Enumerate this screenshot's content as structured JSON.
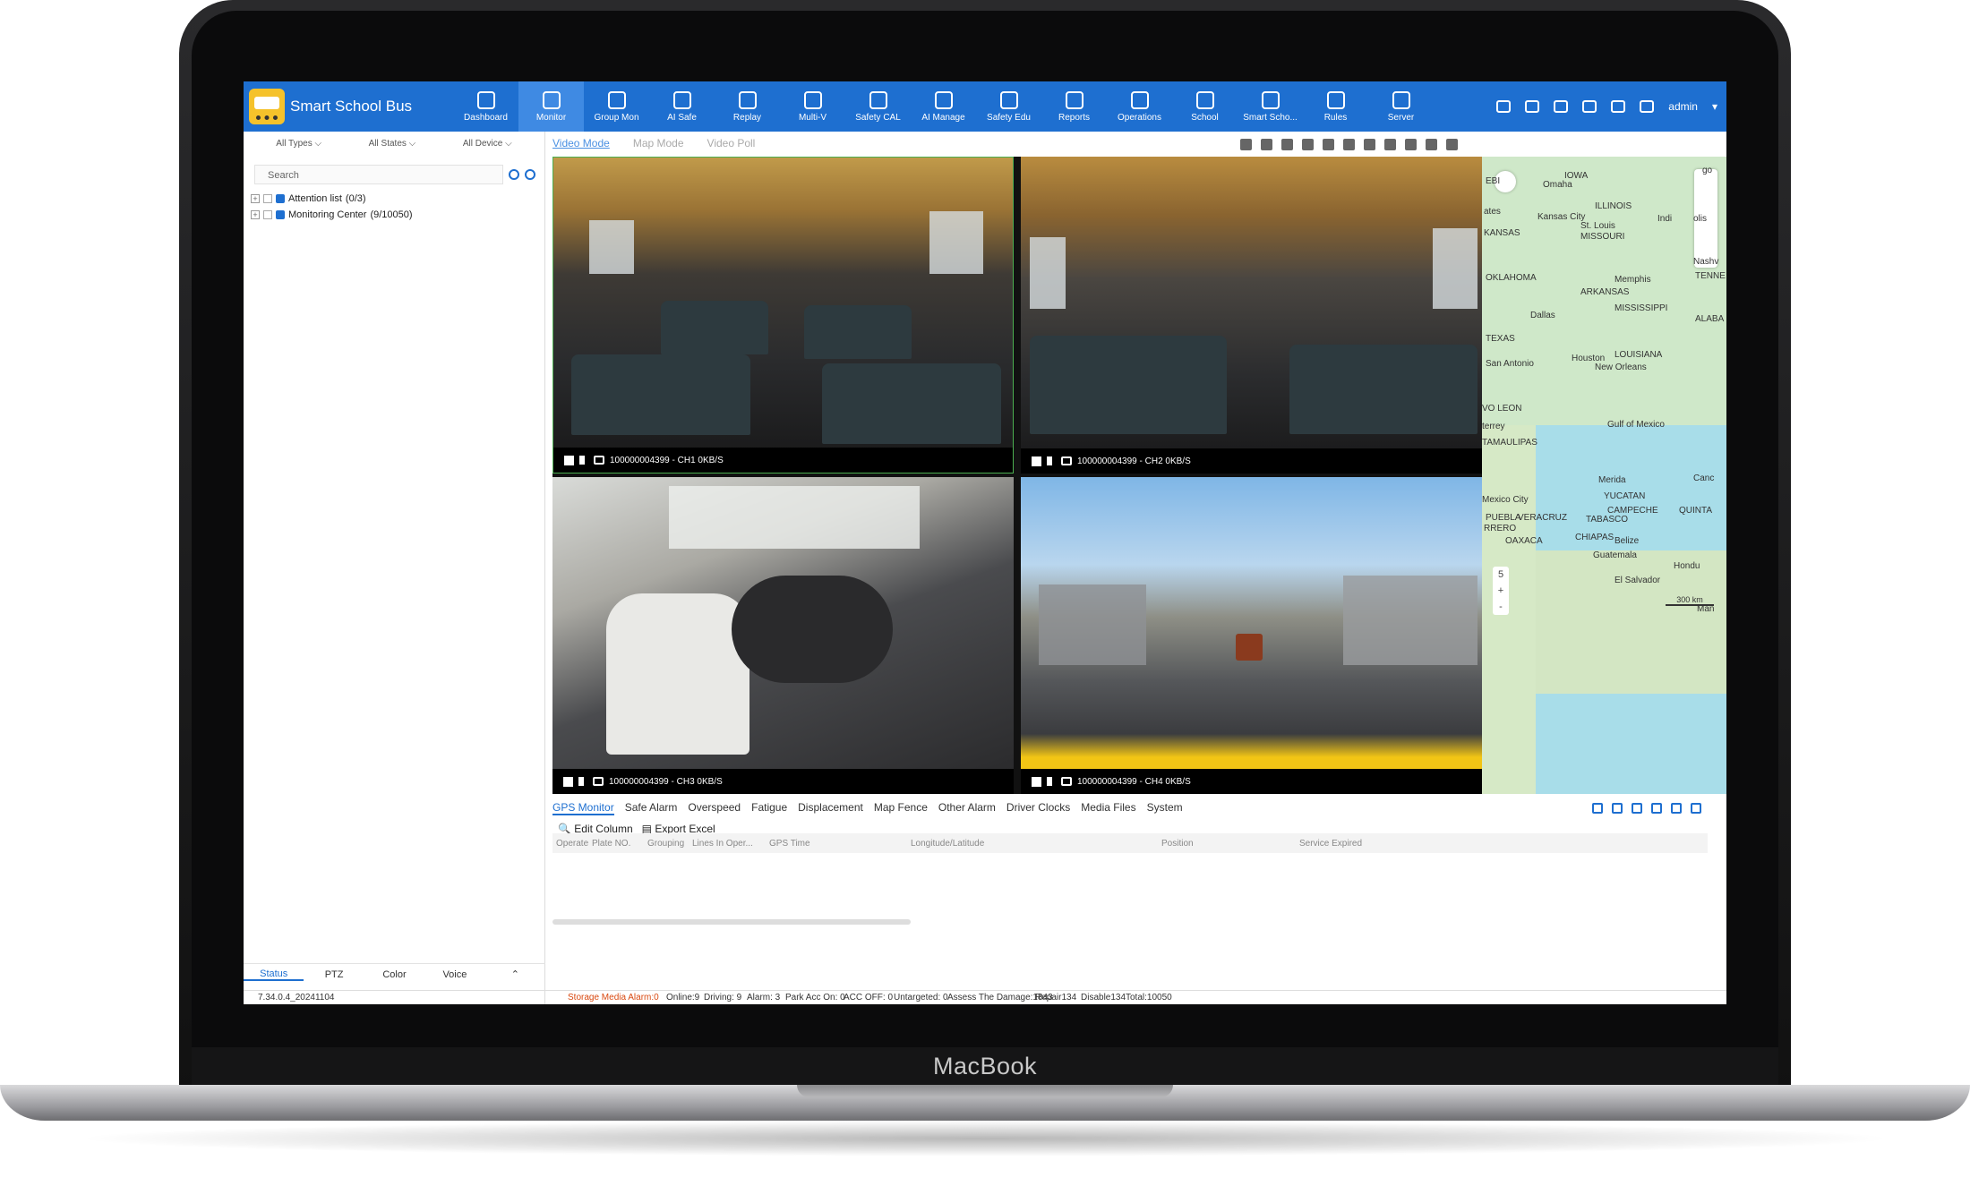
{
  "app": {
    "title": "Smart School Bus",
    "device_label": "MacBook"
  },
  "nav": [
    {
      "label": "Dashboard"
    },
    {
      "label": "Monitor"
    },
    {
      "label": "Group Mon"
    },
    {
      "label": "AI Safe"
    },
    {
      "label": "Replay"
    },
    {
      "label": "Multi-V"
    },
    {
      "label": "Safety CAL"
    },
    {
      "label": "AI Manage"
    },
    {
      "label": "Safety Edu"
    },
    {
      "label": "Reports"
    },
    {
      "label": "Operations"
    },
    {
      "label": "School"
    },
    {
      "label": "Smart Scho..."
    },
    {
      "label": "Rules"
    },
    {
      "label": "Server"
    }
  ],
  "nav_active": "Monitor",
  "user": {
    "name": "admin"
  },
  "filters": {
    "types": "All Types",
    "states": "All States",
    "device": "All Device"
  },
  "search": {
    "placeholder": "Search"
  },
  "tree": [
    {
      "label": "Attention list",
      "count": "(0/3)"
    },
    {
      "label": "Monitoring Center",
      "count": "(9/10050)"
    }
  ],
  "left_tabs": [
    "Status",
    "PTZ",
    "Color",
    "Voice"
  ],
  "version": "7.34.0.4_20241104",
  "modes": [
    "Video Mode",
    "Map Mode",
    "Video Poll"
  ],
  "channels": [
    {
      "label": "100000004399 - CH1 0KB/S"
    },
    {
      "label": "100000004399 - CH2 0KB/S"
    },
    {
      "label": "100000004399 - CH3 0KB/S"
    },
    {
      "label": "100000004399 - CH4 0KB/S"
    }
  ],
  "map_labels": [
    "IOWA",
    "Omaha",
    "Kansas City",
    "St. Louis",
    "KANSAS",
    "MISSOURI",
    "ILLINOIS",
    "OKLAHOMA",
    "ARKANSAS",
    "Memphis",
    "Nashv",
    "TENNE",
    "MISSISSIPPI",
    "ALABA",
    "Dallas",
    "TEXAS",
    "LOUISIANA",
    "Houston",
    "San Antonio",
    "New Orleans",
    "Gulf of Mexico",
    "VO LEON",
    "terrey",
    "TAMAULIPAS",
    "Merida",
    "Canc",
    "YUCATAN",
    "Mexico City",
    "CAMPECHE",
    "QUINTA",
    "PUEBLA",
    "VERACRUZ",
    "TABASCO",
    "RRERO",
    "OAXACA",
    "CHIAPAS",
    "Belize",
    "Guatemala",
    "Hondu",
    "El Salvador",
    "Man",
    "ates",
    "EBI",
    "Indi",
    "olis",
    "go"
  ],
  "map_zoom": "5",
  "map_scale": "300 km",
  "bottom_tabs": [
    "GPS Monitor",
    "Safe Alarm",
    "Overspeed",
    "Fatigue",
    "Displacement",
    "Map Fence",
    "Other Alarm",
    "Driver Clocks",
    "Media Files",
    "System"
  ],
  "actions": {
    "edit_column": "Edit Column",
    "export_excel": "Export Excel"
  },
  "columns": [
    "Operate",
    "Plate NO.",
    "Grouping",
    "Lines In Oper...",
    "GPS Time",
    "Longitude/Latitude",
    "Position",
    "Service Expired"
  ],
  "status": {
    "storage": "Storage Media Alarm:0",
    "online": "Online:9",
    "driving": "Driving: 9",
    "alarm": "Alarm: 3",
    "park": "Park Acc On: 0",
    "acc_off": "ACC OFF: 0",
    "untargeted": "Untargeted: 0",
    "damage": "Assess The Damage:1843",
    "repair": "Repair134",
    "disable": "Disable134",
    "total": "Total:10050"
  },
  "colors": {
    "primary": "#1e6fd0",
    "alarm": "#d9480f"
  }
}
